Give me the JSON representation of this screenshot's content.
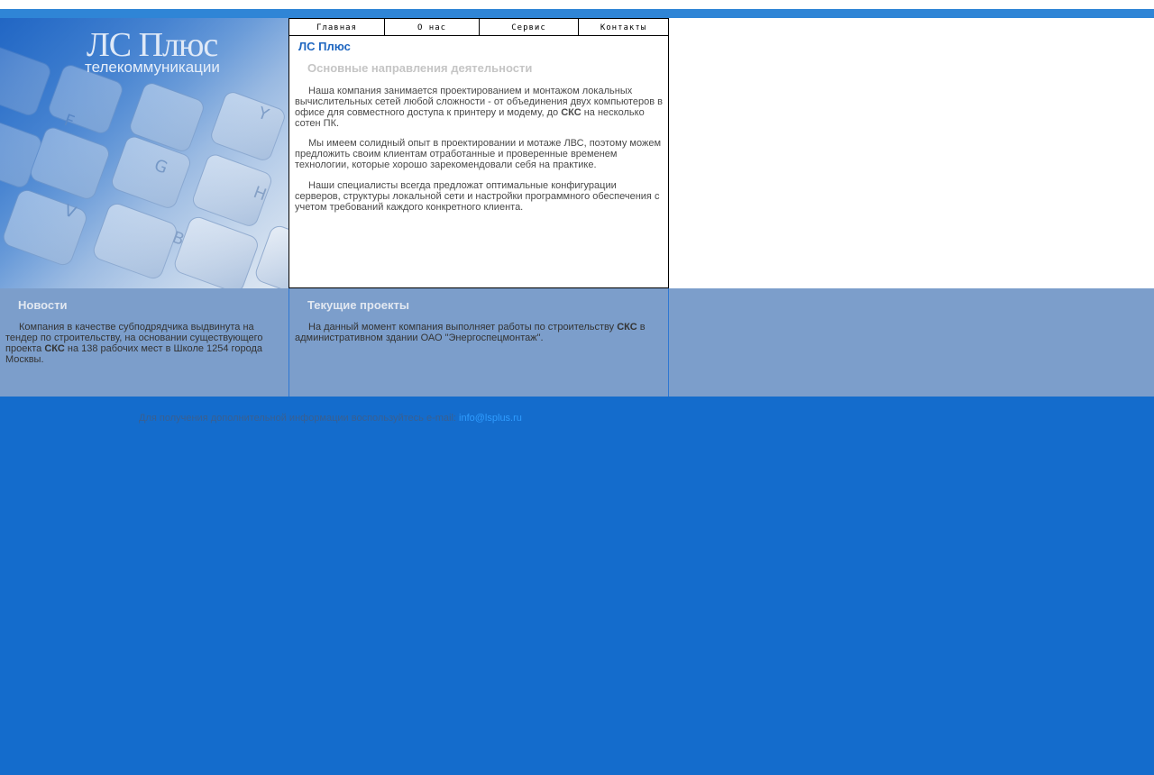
{
  "logo": {
    "title": "ЛС Плюс",
    "subtitle": "телекоммуникации"
  },
  "nav": {
    "items": [
      "Главная",
      "О нас",
      "Сервис",
      "Контакты"
    ]
  },
  "main": {
    "site_title": "ЛС Плюс",
    "section_title": "Основные направления деятельности",
    "p1_a": "Наша компания занимается проектированием и монтажом локальных вычислительных сетей любой сложности - от объединения двух компьютеров в офисе для совместного доступа к принтеру и модему, до ",
    "p1_b": "СКС",
    "p1_c": " на несколько сотен ПК.",
    "p2": "Мы имеем солидный опыт в проектировании и мотаже ЛВС, поэтому можем предложить своим клиентам отработанные и проверенные временем технологии, которые хорошо зарекомендовали себя на практике.",
    "p3": "Наши специалисты всегда предложат оптимальные конфигурации серверов, структуры локальной сети и настройки программного обеспечения с учетом требований каждого конкретного клиента."
  },
  "news": {
    "title": "Новости",
    "text_a": "Компания в качестве субподрядчика выдвинута на тендер по строительству, на основании существующего проекта ",
    "text_b": "СКС",
    "text_c": " на 138 рабочих мест в Школе 1254 города Москвы."
  },
  "projects": {
    "title": "Текущие проекты",
    "text_a": "На данный момент компания выполняет работы по строительству ",
    "text_b": "СКС",
    "text_c": " в административном здании ОАО \"Энергоспецмонтаж\"."
  },
  "footer": {
    "text": "Для получения дополнительной информации воспользуйтесь e-mail: ",
    "email": "info@lsplus.ru"
  },
  "colors": {
    "page_bg": "#146ccc",
    "top_bar": "#2f85d6",
    "lower_band": "#7c9ecb",
    "title_blue": "#1e66c0",
    "link": "#2f9cff"
  }
}
